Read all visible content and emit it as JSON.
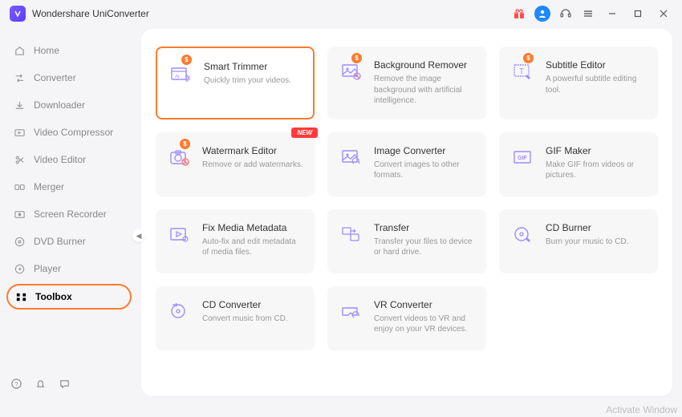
{
  "app": {
    "title": "Wondershare UniConverter"
  },
  "sidebar": {
    "items": [
      {
        "label": "Home"
      },
      {
        "label": "Converter"
      },
      {
        "label": "Downloader"
      },
      {
        "label": "Video Compressor"
      },
      {
        "label": "Video Editor"
      },
      {
        "label": "Merger"
      },
      {
        "label": "Screen Recorder"
      },
      {
        "label": "DVD Burner"
      },
      {
        "label": "Player"
      },
      {
        "label": "Toolbox"
      }
    ],
    "active_index": 9
  },
  "tools": [
    {
      "title": "Smart Trimmer",
      "desc": "Quickly trim your videos.",
      "paid": true,
      "new": false,
      "selected": true,
      "icon": "smart-trimmer-icon"
    },
    {
      "title": "Background Remover",
      "desc": "Remove the image background with artificial intelligence.",
      "paid": true,
      "new": false,
      "selected": false,
      "icon": "background-remover-icon"
    },
    {
      "title": "Subtitle Editor",
      "desc": "A powerful subtitle editing tool.",
      "paid": true,
      "new": false,
      "selected": false,
      "icon": "subtitle-editor-icon"
    },
    {
      "title": "Watermark Editor",
      "desc": "Remove or add watermarks.",
      "paid": true,
      "new": true,
      "selected": false,
      "icon": "watermark-editor-icon"
    },
    {
      "title": "Image Converter",
      "desc": "Convert images to other formats.",
      "paid": false,
      "new": false,
      "selected": false,
      "icon": "image-converter-icon"
    },
    {
      "title": "GIF Maker",
      "desc": "Make GIF from videos or pictures.",
      "paid": false,
      "new": false,
      "selected": false,
      "icon": "gif-maker-icon"
    },
    {
      "title": "Fix Media Metadata",
      "desc": "Auto-fix and edit metadata of media files.",
      "paid": false,
      "new": false,
      "selected": false,
      "icon": "fix-metadata-icon"
    },
    {
      "title": "Transfer",
      "desc": "Transfer your files to device or hard drive.",
      "paid": false,
      "new": false,
      "selected": false,
      "icon": "transfer-icon"
    },
    {
      "title": "CD Burner",
      "desc": "Burn your music to CD.",
      "paid": false,
      "new": false,
      "selected": false,
      "icon": "cd-burner-icon"
    },
    {
      "title": "CD Converter",
      "desc": "Convert music from CD.",
      "paid": false,
      "new": false,
      "selected": false,
      "icon": "cd-converter-icon"
    },
    {
      "title": "VR Converter",
      "desc": "Convert videos to VR and enjoy on your VR devices.",
      "paid": false,
      "new": false,
      "selected": false,
      "icon": "vr-converter-icon"
    }
  ],
  "badges": {
    "dollar": "$",
    "new": "NEW"
  },
  "watermark": "Activate Window"
}
